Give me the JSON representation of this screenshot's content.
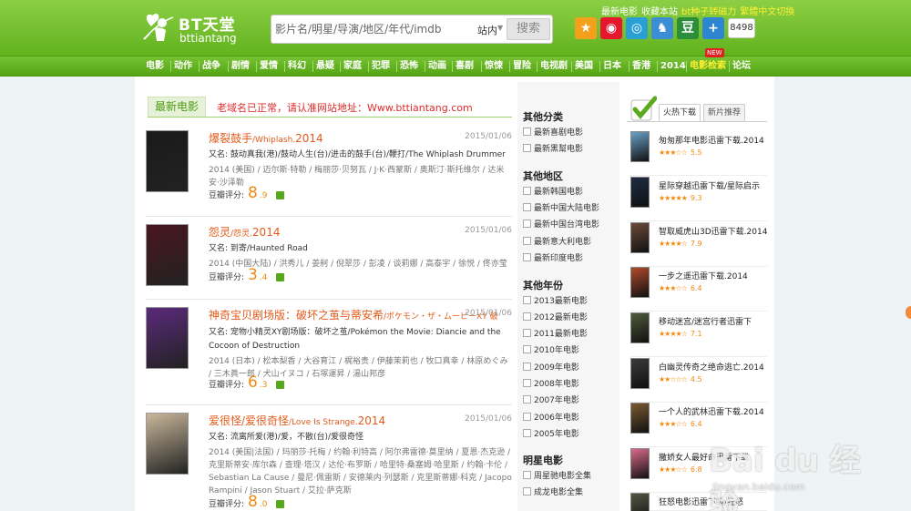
{
  "header": {
    "logo_text": "BT天堂",
    "logo_sub": "bttiantang",
    "search_placeholder": "影片名/明星/导演/地区/年代/imdb",
    "search_scope": "站内",
    "search_button": "搜索",
    "top_links": [
      {
        "label": "最新电影",
        "color": "white"
      },
      {
        "label": "收藏本站",
        "color": "white"
      },
      {
        "label": "bt种子转磁力",
        "color": "yellow"
      },
      {
        "label": "繁體中文切換",
        "color": "yellow"
      }
    ],
    "share_icons": [
      {
        "name": "qzone-share-icon",
        "glyph": "★",
        "color": "#f5a01c"
      },
      {
        "name": "weibo-share-icon",
        "glyph": "◉",
        "color": "#e6162d"
      },
      {
        "name": "tencent-weibo-share-icon",
        "glyph": "◎",
        "color": "#2a9fd6"
      },
      {
        "name": "qq-share-icon",
        "glyph": "♞",
        "color": "#3b8ed6"
      },
      {
        "name": "douban-share-icon",
        "glyph": "豆",
        "color": "#2c8d3b"
      },
      {
        "name": "more-share-icon",
        "glyph": "+",
        "color": "#2e86d1"
      }
    ],
    "share_count": "8498"
  },
  "nav": {
    "items": [
      "电影",
      "动作",
      "战争",
      "剧情",
      "爱情",
      "科幻",
      "悬疑",
      "家庭",
      "犯罪",
      "恐怖",
      "动画",
      "喜剧",
      "惊悚",
      "冒险",
      "电视剧",
      "美国",
      "日本",
      "香港",
      "2014",
      "电影检索",
      "论坛"
    ],
    "highlighted": "电影检索",
    "new_badge": "NEW"
  },
  "content": {
    "tab_label": "最新电影",
    "notice": "老域名已正常，请认准网站地址：Www.bttiantang.com",
    "rating_label": "豆瓣评分:",
    "movies": [
      {
        "title": "爆裂鼓手",
        "title_small": "/Whiplash.",
        "year": "2014",
        "date": "2015/01/06",
        "alias": "又名: 鼓动真我(港)/鼓动人生(台)/进击的鼓手(台)/鞭打/The Whiplash Drummer",
        "cast": "2014 (美国) / 迈尔斯·特勒 / 梅丽莎·贝努瓦 / J·K·西蒙斯 / 奥斯汀·斯托维尔 / 达米安·沙泽勒",
        "score_int": "8",
        "score_dec": ".9",
        "poster_color": "#1a1a1a"
      },
      {
        "title": "怨灵",
        "title_small": "/怨灵.",
        "year": "2014",
        "date": "2015/01/06",
        "alias": "又名: 到寄/Haunted Road",
        "cast": "2014 (中国大陆) / 洪秀儿 / 姜舸 / 倪翠莎 / 彭凌 / 谈莉娜 / 高泰宇 / 徐悦 / 佟亦莹",
        "score_int": "3",
        "score_dec": ".4",
        "poster_color": "#4a1620"
      },
      {
        "title": "神奇宝贝剧场版：破坏之茧与蒂安希",
        "title_small": "/ポケモン・ザ・ムービーXY 破",
        "year": "",
        "date": "2015/01/06",
        "alias": "又名: 宠物小精灵XY剧场版：破坏之茧/Pokémon the Movie: Diancie and the Cocoon of Destruction",
        "cast": "2014 (日本) / 松本梨香 / 大谷育江 / 梶裕贵 / 伊藤茉莉也 / 牧口真幸 / 林原めぐみ / 三木眞一郎 / 犬山イヌコ / 石塚運昇 / 湯山邦彦",
        "score_int": "6",
        "score_dec": ".3",
        "poster_color": "#5b2a7c"
      },
      {
        "title": "爱很怪/爱很奇怪",
        "title_small": "/Love Is Strange.",
        "year": "2014",
        "date": "2015/01/06",
        "alias": "又名: 流离所爱(港)/爱，不散(台)/爱很奇怪",
        "cast": "2014 (美国|法国) / 玛丽莎·托梅 / 约翰·利特高 / 阿尔弗雷德·莫里纳 / 夏恩·杰克逊 / 克里斯蒂安·库尔森 / 查理·塔汉 / 达伦·布罗斯 / 哈里特·桑塞姆·哈里斯 / 约翰·卡伦 / Sebastian La Cause / 曼尼·佩雷斯 / 安德莱内·列瑟斯 / 克里斯蒂娜·科克 / Jacopo Rampini / Jason Stuart / 艾拉·萨克斯",
        "score_int": "8",
        "score_dec": ".0",
        "poster_color": "#c9b79b"
      }
    ]
  },
  "categories": [
    {
      "heading": "其他分类",
      "items": [
        "最新喜剧电影",
        "最新黑幫电影"
      ]
    },
    {
      "heading": "其他地区",
      "items": [
        "最新韩国电影",
        "最新中国大陆电影",
        "最新中国台湾电影",
        "最新意大利电影",
        "最新印度电影"
      ]
    },
    {
      "heading": "其他年份",
      "items": [
        "2013最新电影",
        "2012最新电影",
        "2011最新电影",
        "2010年电影",
        "2009年电影",
        "2008年电影",
        "2007年电影",
        "2006年电影",
        "2005年电影"
      ]
    },
    {
      "heading": "明星电影",
      "items": [
        "周星驰电影全集",
        "成龙电影全集",
        "李连杰电影全集"
      ]
    }
  ],
  "right": {
    "tab_hot": "火热下载",
    "tab_new": "新片推荐",
    "items": [
      {
        "title": "匆匆那年电影迅雷下载.2014",
        "stars": "★★★☆☆",
        "score": "5.5",
        "color": "#6aa0c8"
      },
      {
        "title": "星际穿越迅雷下载/星际启示",
        "stars": "★★★★★",
        "score": "9.3",
        "color": "#1d2c44"
      },
      {
        "title": "智取威虎山3D迅雷下载.2014",
        "stars": "★★★★☆",
        "score": "7.9",
        "color": "#6b4b3a"
      },
      {
        "title": "一步之遥迅雷下载.2014",
        "stars": "★★★☆☆",
        "score": "6.4",
        "color": "#b04a2a"
      },
      {
        "title": "移动迷宫/迷宫行者迅雷下",
        "stars": "★★★★☆",
        "score": "7.1",
        "color": "#4f5a3a"
      },
      {
        "title": "白幽灵传奇之绝命逃亡.2014",
        "stars": "★★☆☆☆",
        "score": "4.5",
        "color": "#3a3a3a"
      },
      {
        "title": "一个人的武林迅雷下载.2014",
        "stars": "★★★☆☆",
        "score": "6.4",
        "color": "#7a5a30"
      },
      {
        "title": "撒娇女人最好命迅雷下载",
        "stars": "★★★☆☆",
        "score": "6.8",
        "color": "#d86a8a"
      },
      {
        "title": "狂怒电影迅雷下载/狂怒",
        "stars": "★★★★☆",
        "score": "",
        "color": "#555544"
      }
    ]
  },
  "watermark": {
    "baidu": "Bai du 经验",
    "site": "jingyan.baidu.com"
  }
}
